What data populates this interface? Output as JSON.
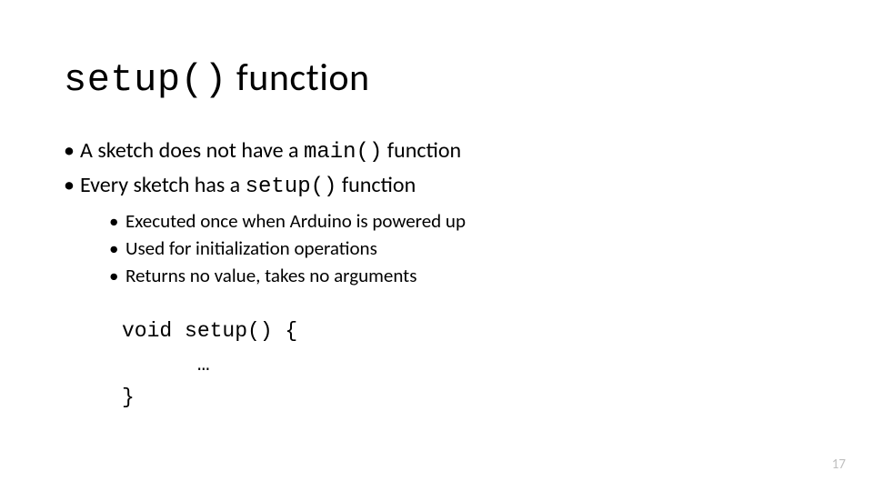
{
  "title": {
    "code": "setup()",
    "rest": " function"
  },
  "bullets": {
    "b1": {
      "pre": "A sketch does not have a ",
      "code": "main()",
      "post": " function"
    },
    "b2": {
      "pre": "Every sketch has a ",
      "code": "setup()",
      "post": " function"
    },
    "sub": [
      "Executed once when Arduino is powered up",
      "Used for initialization operations",
      "Returns no value, takes no arguments"
    ]
  },
  "code": {
    "line1": "void setup() {",
    "line2": "      …",
    "line3": "}"
  },
  "page_number": "17"
}
